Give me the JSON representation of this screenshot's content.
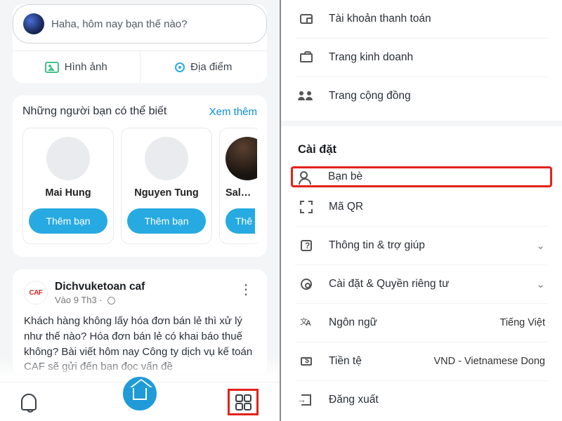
{
  "left": {
    "composer": {
      "prompt": "Haha, hôm nay bạn thế nào?",
      "photo_label": "Hình ảnh",
      "location_label": "Địa điểm"
    },
    "suggestions": {
      "title": "Những người bạn có thể biết",
      "see_more": "Xem thêm",
      "cards": [
        {
          "name": "Mai Hung",
          "button": "Thêm bạn"
        },
        {
          "name": "Nguyen Tung",
          "button": "Thêm bạn"
        },
        {
          "name": "Salmo",
          "button": "Thê"
        }
      ]
    },
    "post": {
      "logo_text": "CAF",
      "author": "Dichvuketoan caf",
      "time": "Vào 9 Th3",
      "body": "Khách hàng không lấy hóa đơn bán lẻ thì xử lý như thế nào? Hóa đơn bán lẻ có khai báo thuế không? Bài viết hôm nay Công ty dịch vụ kế toán CAF sẽ gửi đến bạn đọc vấn đề"
    }
  },
  "right": {
    "upper": [
      {
        "icon": "wallet",
        "label": "Tài khoản thanh toán"
      },
      {
        "icon": "briefcase",
        "label": "Trang kinh doanh"
      },
      {
        "icon": "community",
        "label": "Trang cộng đồng"
      }
    ],
    "section_title": "Cài đặt",
    "settings": [
      {
        "icon": "friend",
        "label": "Bạn bè",
        "highlight": true
      },
      {
        "icon": "qr",
        "label": "Mã QR"
      },
      {
        "icon": "help",
        "label": "Thông tin & trợ giúp",
        "chevron": true
      },
      {
        "icon": "gear",
        "label": "Cài đặt & Quyền riêng tư",
        "chevron": true
      },
      {
        "icon": "lang",
        "label": "Ngôn ngữ",
        "value": "Tiếng Việt"
      },
      {
        "icon": "currency",
        "label": "Tiền tệ",
        "value": "VND - Vietnamese Dong"
      },
      {
        "icon": "logout",
        "label": "Đăng xuất"
      }
    ]
  }
}
